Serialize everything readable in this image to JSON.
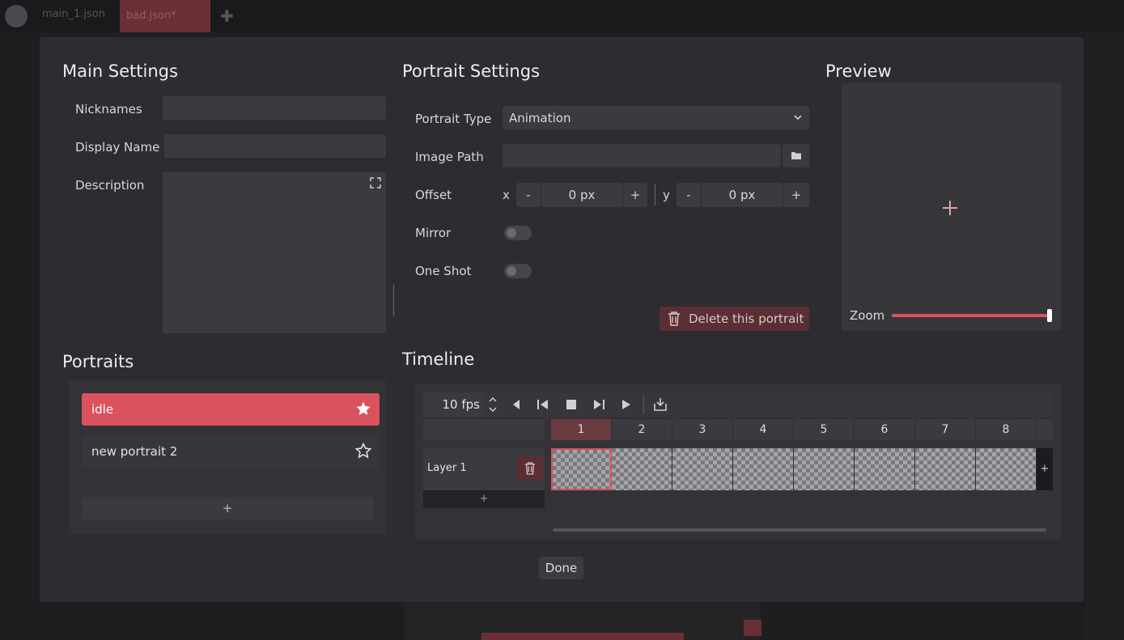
{
  "background": {
    "tabs": [
      "main_1.json",
      "bad.json*"
    ]
  },
  "main_settings": {
    "title": "Main Settings",
    "nicknames_label": "Nicknames",
    "nicknames_value": "",
    "display_name_label": "Display Name",
    "display_name_value": "",
    "description_label": "Description",
    "description_value": ""
  },
  "portrait_settings": {
    "title": "Portrait Settings",
    "type_label": "Portrait Type",
    "type_value": "Animation",
    "image_path_label": "Image Path",
    "image_path_value": "",
    "offset_label": "Offset",
    "x_label": "x",
    "y_label": "y",
    "x_value": "0 px",
    "y_value": "0 px",
    "minus": "-",
    "plus": "+",
    "mirror_label": "Mirror",
    "mirror_on": false,
    "one_shot_label": "One Shot",
    "one_shot_on": false,
    "delete_label": "Delete this portrait"
  },
  "preview": {
    "title": "Preview",
    "zoom_label": "Zoom",
    "zoom_level": 1.0
  },
  "portraits": {
    "title": "Portraits",
    "items": [
      {
        "name": "idle",
        "selected": true,
        "default": true
      },
      {
        "name": "new portrait 2",
        "selected": false,
        "default": false
      }
    ],
    "add_label": "+"
  },
  "timeline": {
    "title": "Timeline",
    "fps": "10 fps",
    "frames": [
      "1",
      "2",
      "3",
      "4",
      "5",
      "6",
      "7",
      "8"
    ],
    "active_frame": "1",
    "layer_name": "Layer 1",
    "add_layer": "+",
    "add_frame": "+"
  },
  "footer": {
    "done_label": "Done"
  },
  "colors": {
    "accent": "#d9525e",
    "dialog_bg": "#2d2d31",
    "field_bg": "#3a3a40"
  }
}
